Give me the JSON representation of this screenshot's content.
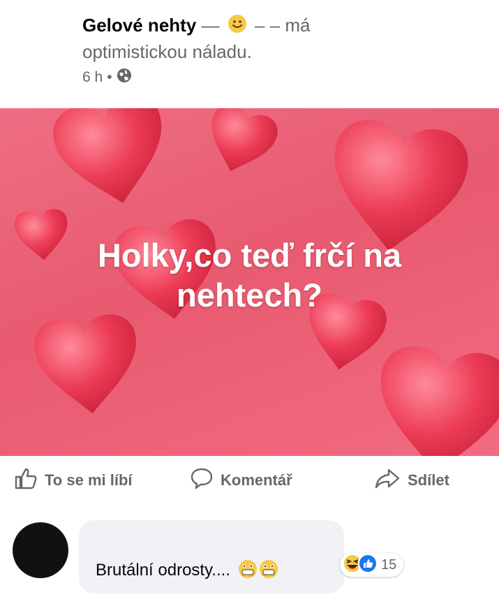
{
  "post": {
    "page_name": "Gelové nehty",
    "dash": "—",
    "feeling_prefix": "– – má",
    "feeling_text": "optimistickou náladu.",
    "time": "6 h",
    "separator": "•",
    "privacy_icon": "globe-icon",
    "feeling_icon": "smile-emoji-icon"
  },
  "image": {
    "caption_line1": "Holky,co teď frčí na",
    "caption_line2": "nehtech?",
    "background_color": "#eb6478",
    "heart_color": "#e8364f"
  },
  "actions": {
    "like_label": "To se mi líbí",
    "comment_label": "Komentář",
    "share_label": "Sdílet"
  },
  "comment": {
    "text": "Brutální odrosty....",
    "text_emojis": "shocked-emoji-icon x2",
    "reactions": [
      "haha-reaction-icon",
      "like-reaction-icon"
    ],
    "reaction_count": "15"
  }
}
